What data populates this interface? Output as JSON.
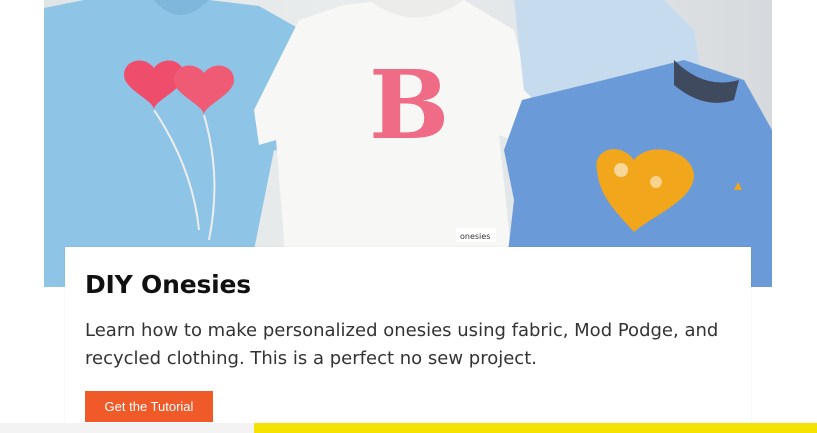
{
  "hero": {
    "image_description_icon": "onesies-photo",
    "onesie_letter": "B",
    "tag_text": "onesies",
    "colors": {
      "light_blue": "#8ec4e6",
      "royal_blue": "#6b9ad8",
      "pink": "#ef4d6c",
      "yellow": "#f1a61c",
      "white": "#f7f7f5"
    }
  },
  "card": {
    "title": "DIY Onesies",
    "description": "Learn how to make personalized onesies using fabric, Mod Podge, and recycled clothing. This is a perfect no sew project.",
    "cta_label": "Get the Tutorial",
    "cta_color": "#f05a28"
  },
  "footer": {
    "accent_color": "#f4e300"
  }
}
